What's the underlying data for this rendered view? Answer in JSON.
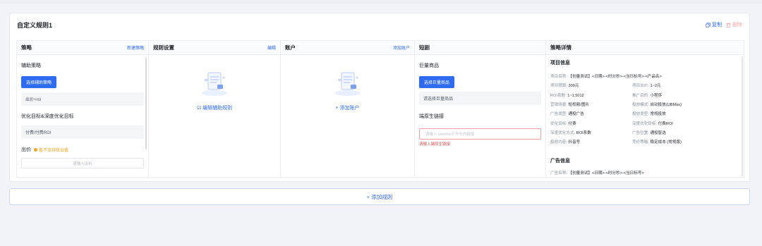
{
  "rule": {
    "title": "自定义规则1",
    "copy_label": "复制",
    "delete_label": "删除"
  },
  "columns": {
    "strategy": {
      "title": "策略",
      "link": "新建策略",
      "aux_label": "辅助策略",
      "select_button": "选择辅助策略",
      "bid_value": "出价+roi",
      "goal_label": "优化目标&深度优化目标",
      "goal_value": "付费/付费ROI",
      "bid_label": "出价",
      "bid_warning": "暂不支持统出值",
      "bid_placeholder": "请输入出价"
    },
    "rules": {
      "title": "规则设置",
      "link": "编辑",
      "empty_action": "编辑辅助规则"
    },
    "account": {
      "title": "账户",
      "link": "添加账户",
      "empty_action": "添加账户"
    },
    "short_drama": {
      "title": "短剧",
      "goods_label": "巨量商品",
      "select_goods_button": "选择巨量商品",
      "goods_placeholder": "请选择巨量商品",
      "link_label": "端原生链接",
      "link_placeholder": "请输入 aweme:// 开头的链接",
      "link_error": "请输入端原生链接"
    },
    "detail": {
      "title": "策略详情",
      "project_section": "项目信息",
      "project_fields": [
        {
          "k": "项目名称:",
          "v": "【创量测试】<日期>-<时分秒>-<当日标号>-<产品名>"
        },
        {
          "k": "项目预算:",
          "v": "300元"
        },
        {
          "k": "项目出价:",
          "v": "1~2元"
        },
        {
          "k": "ROI系数:",
          "v": "1~1.5012"
        },
        {
          "k": "推广目的:",
          "v": "小程序"
        },
        {
          "k": "营销场景:",
          "v": "短视频/图片"
        },
        {
          "k": "投放模式:",
          "v": "自动投放(UBMax)"
        },
        {
          "k": "广告类型:",
          "v": "通投广告"
        },
        {
          "k": "投放类型:",
          "v": "常规投放"
        },
        {
          "k": "优化目标:",
          "v": "付费"
        },
        {
          "k": "深度优化目标:",
          "v": "付费ROI"
        },
        {
          "k": "深度优化方式:",
          "v": "ROI系数"
        },
        {
          "k": "广告位置:",
          "v": "通投智选"
        },
        {
          "k": "投放内容:",
          "v": "抖音号"
        },
        {
          "k": "竞价策略:",
          "v": "稳定成本 (常规版)"
        }
      ],
      "ad_section": "广告信息",
      "ad_fields": [
        {
          "k": "广告名称:",
          "v": "【创量测试】<日期>-<时分秒>-<当日标号>"
        }
      ]
    }
  },
  "add_rule_label": "+ 添加规则",
  "colors": {
    "primary": "#2f6bf0",
    "warning": "#f5a623",
    "error": "#e34d4d"
  }
}
